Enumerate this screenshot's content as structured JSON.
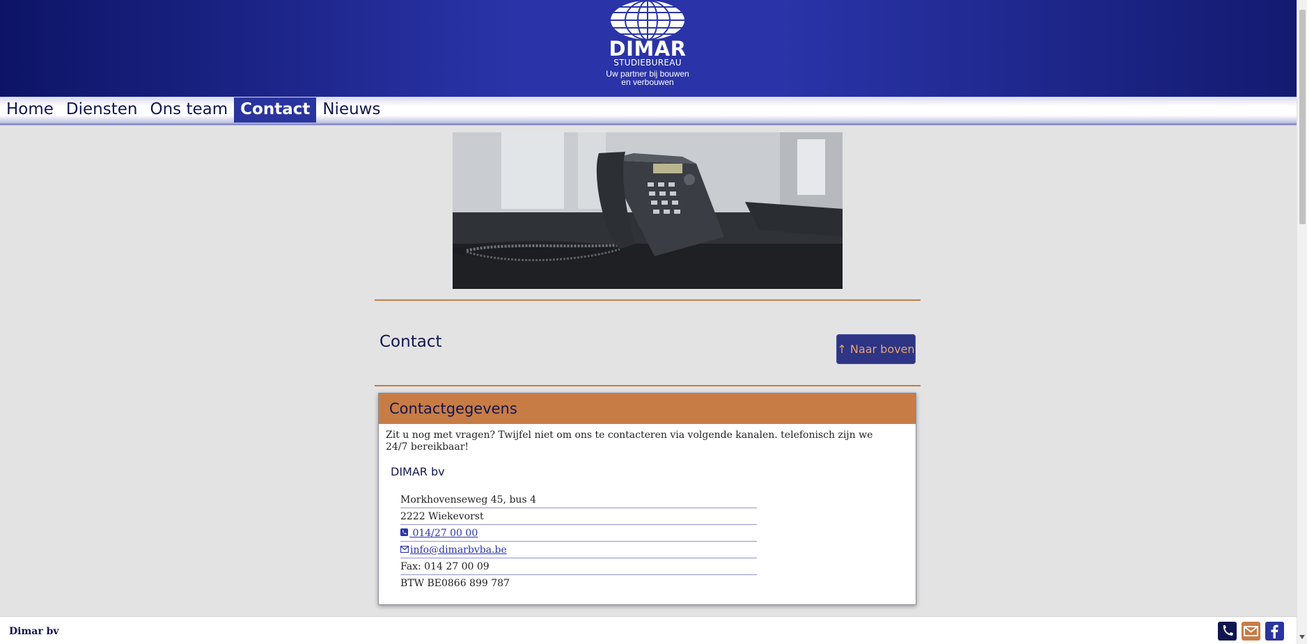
{
  "header": {
    "brand": "DIMAR",
    "subbrand": "STUDIEBUREAU",
    "tagline_line1": "Uw partner bij bouwen",
    "tagline_line2": "en verbouwen"
  },
  "nav": {
    "items": [
      {
        "label": "Home",
        "active": false
      },
      {
        "label": "Diensten",
        "active": false
      },
      {
        "label": "Ons team",
        "active": false
      },
      {
        "label": "Contact",
        "active": true
      },
      {
        "label": "Nieuws",
        "active": false
      }
    ]
  },
  "hero": {
    "icon": "desk-phone-photo"
  },
  "page": {
    "title": "Contact",
    "back_to_top_label": "↑ Naar boven"
  },
  "contact_card": {
    "title": "Contactgegevens",
    "intro": "Zit u nog met vragen? Twijfel niet om ons te contacteren via volgende kanalen. telefonisch zijn we 24/7 bereikbaar!",
    "company": "DIMAR bv",
    "address_line1": "Morkhovenseweg 45, bus 4",
    "address_line2": "2222 Wiekevorst",
    "phone": " 014/27 00 00",
    "email": "info@dimarbvba.be",
    "fax": "Fax: 014 27 00 09",
    "vat": "BTW BE0866 899 787"
  },
  "footer": {
    "name": "Dimar bv",
    "icons": [
      "phone-icon",
      "mail-icon",
      "facebook-icon"
    ]
  },
  "colors": {
    "navy": "#111650",
    "blue": "#2a349e",
    "accent": "#c87c45",
    "background": "#e3e3e3"
  }
}
